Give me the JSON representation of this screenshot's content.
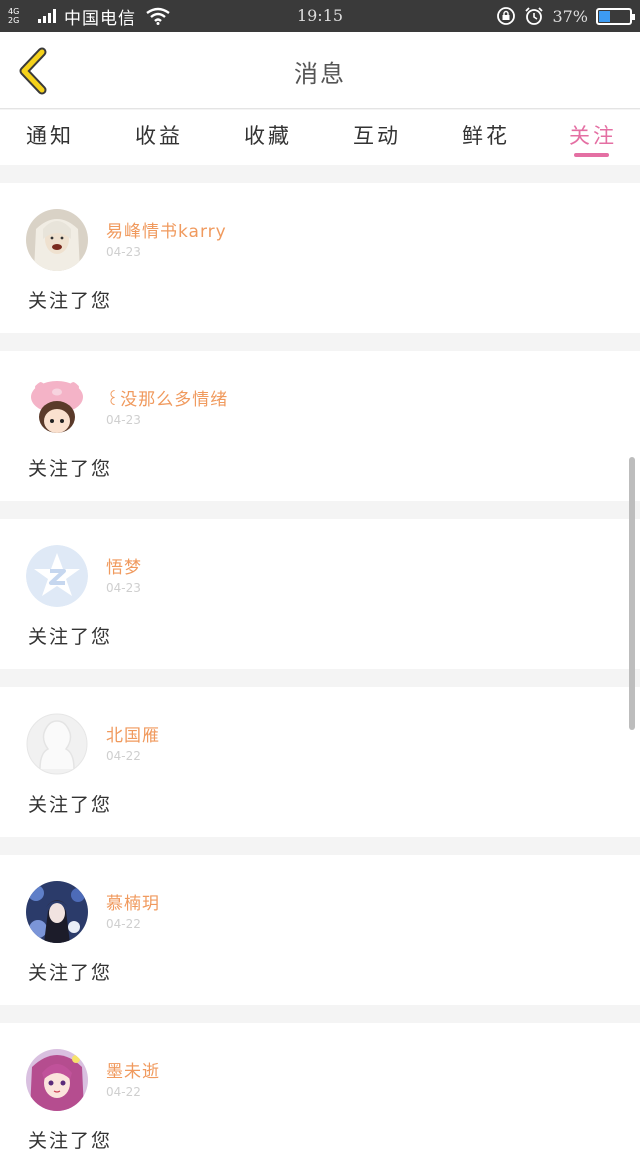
{
  "status_bar": {
    "network_top": "4G",
    "network_bottom": "2G",
    "carrier": "中国电信",
    "time": "19:15",
    "battery_percent": "37%",
    "battery_level": 0.37,
    "icons": [
      "signal-icon",
      "wifi-icon",
      "lock-rotation-icon",
      "alarm-icon",
      "battery-icon"
    ]
  },
  "header": {
    "title": "消息",
    "back_icon": "chevron-left-icon",
    "accent_color": "#f5d21b"
  },
  "tabs": [
    {
      "label": "通知",
      "active": false
    },
    {
      "label": "收益",
      "active": false
    },
    {
      "label": "收藏",
      "active": false
    },
    {
      "label": "互动",
      "active": false
    },
    {
      "label": "鲜花",
      "active": false
    },
    {
      "label": "关注",
      "active": true
    }
  ],
  "colors": {
    "active_tab": "#e46fa3",
    "username": "#f09a5e",
    "date": "#cfcfcf"
  },
  "notifications": [
    {
      "username": "易峰情书karry",
      "date": "04-23",
      "action": "关注了您",
      "avatar": "avatar-photo"
    },
    {
      "username": "꒰没那么多情绪",
      "date": "04-23",
      "action": "关注了您",
      "avatar": "avatar-cartoon-pig-hat"
    },
    {
      "username": "悟梦",
      "date": "04-23",
      "action": "关注了您",
      "avatar": "avatar-default-qq"
    },
    {
      "username": "北国雁",
      "date": "04-22",
      "action": "关注了您",
      "avatar": "avatar-default-silhouette"
    },
    {
      "username": "慕楠玥",
      "date": "04-22",
      "action": "关注了您",
      "avatar": "avatar-anime-dark"
    },
    {
      "username": "墨未逝",
      "date": "04-22",
      "action": "关注了您",
      "avatar": "avatar-anime-pink"
    }
  ]
}
